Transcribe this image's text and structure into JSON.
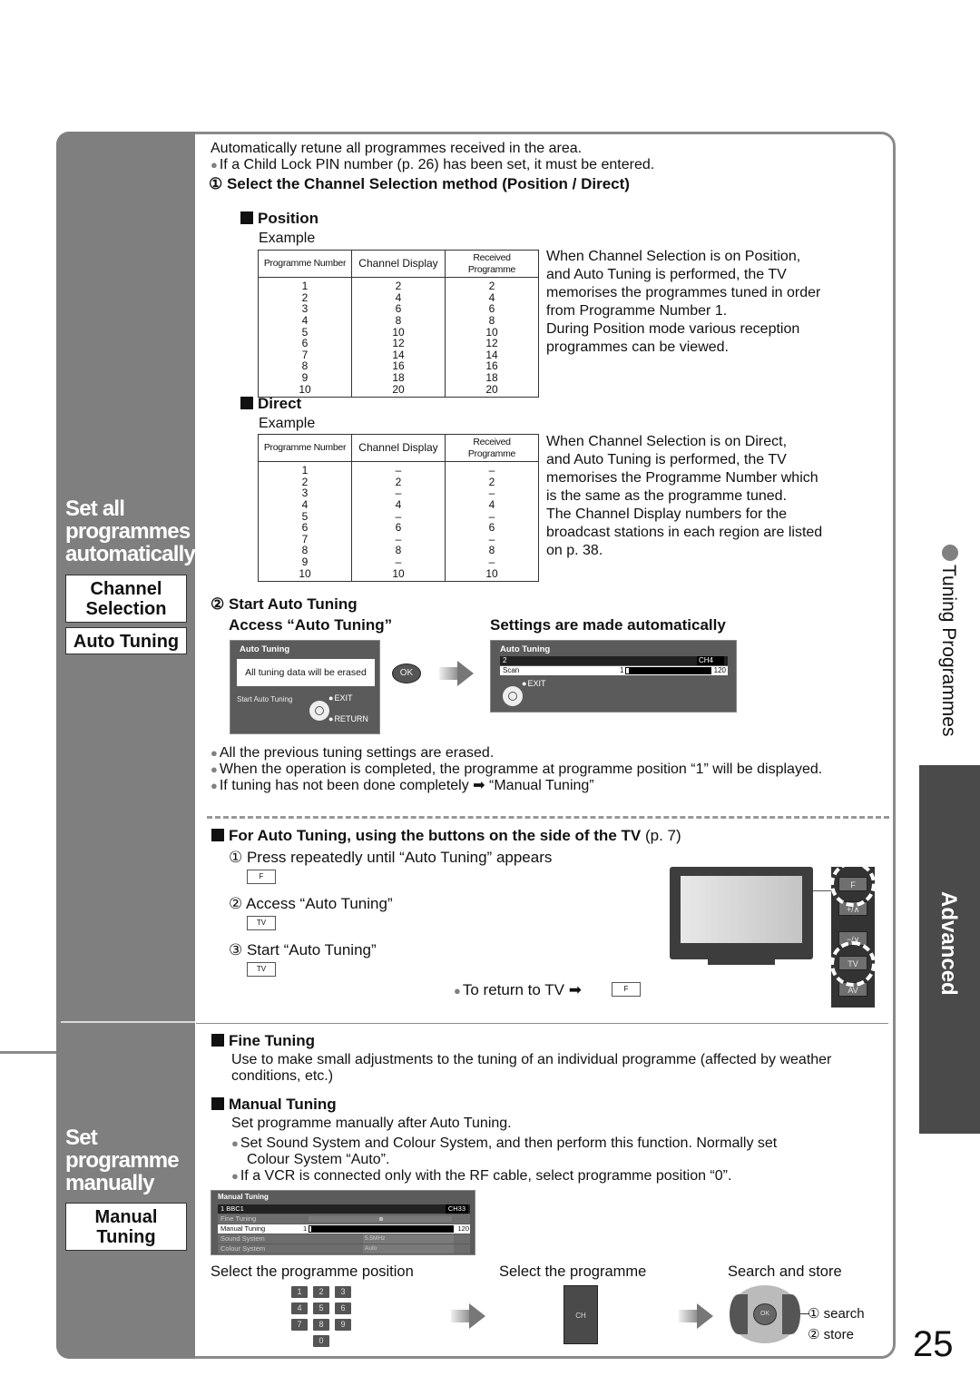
{
  "page_number": "25",
  "side_tab": {
    "section_label": "Tuning Programmes",
    "chapter_label": "Advanced"
  },
  "sidebar": {
    "auto_section_title_lines": [
      "Set all",
      "programmes",
      "automatically"
    ],
    "auto_menu_boxes": [
      {
        "lines": [
          "Channel",
          "Selection"
        ]
      },
      {
        "lines": [
          "Auto Tuning"
        ]
      }
    ],
    "manual_section_title_lines": [
      "Set",
      "programme",
      "manually"
    ],
    "manual_menu_box": {
      "lines": [
        "Manual",
        "Tuning"
      ]
    }
  },
  "auto": {
    "intro": "Automatically retune all programmes received in the area.",
    "intro_note": "If a Child Lock PIN number (p. 26) has been set, it must be entered.",
    "step1_title": "① Select the Channel Selection method (Position / Direct)",
    "position": {
      "heading": "Position",
      "example_label": "Example",
      "columns": [
        "Programme Number",
        "Channel Display",
        "Received Programme"
      ],
      "rows": [
        [
          "1",
          "2",
          "2"
        ],
        [
          "2",
          "4",
          "4"
        ],
        [
          "3",
          "6",
          "6"
        ],
        [
          "4",
          "8",
          "8"
        ],
        [
          "5",
          "10",
          "10"
        ],
        [
          "6",
          "12",
          "12"
        ],
        [
          "7",
          "14",
          "14"
        ],
        [
          "8",
          "16",
          "16"
        ],
        [
          "9",
          "18",
          "18"
        ],
        [
          "10",
          "20",
          "20"
        ]
      ],
      "description_lines": [
        "When Channel Selection is on Position,",
        "and Auto Tuning is performed, the TV",
        "memorises the programmes tuned in order",
        "from Programme Number 1.",
        "During Position mode various reception",
        "programmes can be viewed."
      ]
    },
    "direct": {
      "heading": "Direct",
      "example_label": "Example",
      "columns": [
        "Programme Number",
        "Channel Display",
        "Received Programme"
      ],
      "rows": [
        [
          "1",
          "–",
          "–"
        ],
        [
          "2",
          "2",
          "2"
        ],
        [
          "3",
          "–",
          "–"
        ],
        [
          "4",
          "4",
          "4"
        ],
        [
          "5",
          "–",
          "–"
        ],
        [
          "6",
          "6",
          "6"
        ],
        [
          "7",
          "–",
          "–"
        ],
        [
          "8",
          "8",
          "8"
        ],
        [
          "9",
          "–",
          "–"
        ],
        [
          "10",
          "10",
          "10"
        ]
      ],
      "description_lines": [
        "When Channel Selection is on Direct,",
        "and Auto Tuning is performed, the TV",
        "memorises the Programme Number which",
        "is the same as the programme tuned.",
        "The Channel Display numbers for the",
        "broadcast stations in each region are listed",
        "on p. 38."
      ]
    },
    "step2_title": "② Start Auto Tuning",
    "access_label": "Access “Auto Tuning”",
    "settings_label": "Settings are made automatically",
    "osd_confirm": {
      "title": "Auto Tuning",
      "message": "All tuning data will be erased",
      "start_label": "Start Auto Tuning",
      "exit_label": "EXIT",
      "return_label": "RETURN"
    },
    "ok_button_label": "OK",
    "osd_progress": {
      "title": "Auto Tuning",
      "row1_left": "2",
      "row1_right": "CH4",
      "scan_label": "Scan",
      "scan_min": "1",
      "scan_max": "120",
      "scan_progress_fraction": 0.03,
      "exit_label": "EXIT"
    },
    "notes": [
      "All the previous tuning settings are erased.",
      "When the operation is completed, the programme at programme position “1” will be displayed.",
      "If tuning has not been done completely ➡ “Manual Tuning”"
    ]
  },
  "side_buttons": {
    "heading": "For Auto Tuning, using the buttons on the side of the TV",
    "heading_ref": "(p. 7)",
    "steps": [
      {
        "text": "① Press repeatedly until “Auto Tuning” appears",
        "key": "F"
      },
      {
        "text": "② Access “Auto Tuning”",
        "key": "TV"
      },
      {
        "text": "③ Start “Auto Tuning”",
        "key": "TV"
      }
    ],
    "return_text": "To return to TV ➡",
    "return_key": "F",
    "tv_panel_buttons": [
      "F",
      "+/∧",
      "−/∨",
      "TV",
      "AV"
    ]
  },
  "manual": {
    "fine_heading": "Fine Tuning",
    "fine_desc": "Use to make small adjustments to the tuning of an individual programme (affected by weather conditions, etc.)",
    "manual_heading": "Manual Tuning",
    "manual_desc": "Set programme manually after Auto Tuning.",
    "manual_notes": [
      "Set Sound System and Colour System, and then perform this function. Normally set Colour System “Auto”.",
      "If a VCR is connected only with the RF cable, select programme position “0”."
    ],
    "osd": {
      "title": "Manual Tuning",
      "header_left": "1 BBC1",
      "header_right": "CH33",
      "rows": [
        {
          "label": "Fine Tuning",
          "value": ""
        },
        {
          "label": "Manual Tuning",
          "min": "1",
          "max": "120"
        },
        {
          "label": "Sound System",
          "value": "5.5MHz"
        },
        {
          "label": "Colour System",
          "value": "Auto"
        }
      ]
    },
    "flow": [
      {
        "label": "Select the programme position"
      },
      {
        "label": "Select the programme"
      },
      {
        "label": "Search and store"
      }
    ],
    "numpad_keys": [
      "1",
      "2",
      "3",
      "4",
      "5",
      "6",
      "7",
      "8",
      "9",
      "0"
    ],
    "ch_key": "CH",
    "ok_key": "OK",
    "search_label": "① search",
    "store_label": "② store"
  }
}
